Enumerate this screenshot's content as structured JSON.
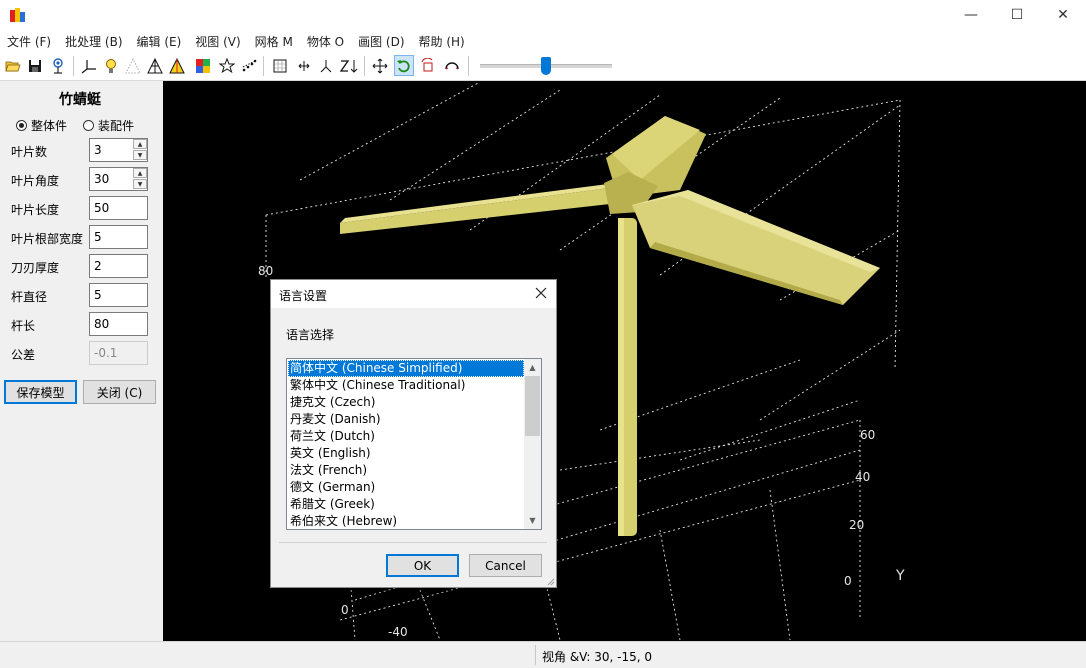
{
  "window": {
    "minimize_glyph": "—",
    "maximize_glyph": "☐",
    "close_glyph": "✕"
  },
  "menu": [
    {
      "id": "file",
      "label": "文件 (F)"
    },
    {
      "id": "batch",
      "label": "批处理 (B)"
    },
    {
      "id": "edit",
      "label": "编辑 (E)"
    },
    {
      "id": "view",
      "label": "视图 (V)"
    },
    {
      "id": "mesh",
      "label": "网格 M"
    },
    {
      "id": "object",
      "label": "物体 O"
    },
    {
      "id": "draw",
      "label": "画图 (D)"
    },
    {
      "id": "help",
      "label": "帮助 (H)"
    }
  ],
  "toolbar": {
    "icons": [
      "open-folder-icon",
      "save-icon",
      "network-icon",
      "axes-icon",
      "lightbulb-icon",
      "mesh-points-icon",
      "wireframe-triangle-icon",
      "colored-triangle-icon",
      "color-map-icon",
      "star-icon",
      "scatter-icon",
      "grid-box-icon",
      "resize-icon",
      "axis-y-icon",
      "zoom-z-icon",
      "move-icon",
      "rotate-icon",
      "box-rotate-icon",
      "arc-icon"
    ],
    "active_icon": "rotate-icon",
    "slider_value_fraction": 0.5
  },
  "panel": {
    "title": "竹蜻蜓",
    "mode_options": [
      "整体件",
      "装配件"
    ],
    "selected_mode": "整体件",
    "params": [
      {
        "label": "叶片数",
        "value": "3",
        "spinner": true,
        "enabled": true
      },
      {
        "label": "叶片角度",
        "value": "30",
        "spinner": true,
        "enabled": true
      },
      {
        "label": "叶片长度",
        "value": "50",
        "spinner": false,
        "enabled": true
      },
      {
        "label": "叶片根部宽度",
        "value": "5",
        "spinner": false,
        "enabled": true
      },
      {
        "label": "刀刃厚度",
        "value": "2",
        "spinner": false,
        "enabled": true
      },
      {
        "label": "杆直径",
        "value": "5",
        "spinner": false,
        "enabled": true
      },
      {
        "label": "杆长",
        "value": "80",
        "spinner": false,
        "enabled": true
      },
      {
        "label": "公差",
        "value": "-0.1",
        "spinner": false,
        "enabled": false
      }
    ],
    "save_button": "保存模型",
    "close_button": "关闭 (C)"
  },
  "viewport": {
    "background": "#000000",
    "model_color": "#d9d27a",
    "grid_color": "#e6e6e6",
    "axis_labels": [
      "80",
      "0",
      "-40",
      "60",
      "40",
      "20",
      "0",
      "Y"
    ]
  },
  "dialog": {
    "title": "语言设置",
    "prompt": "语言选择",
    "languages": [
      "简体中文 (Chinese Simplified)",
      "繁体中文 (Chinese Traditional)",
      "捷克文 (Czech)",
      "丹麦文 (Danish)",
      "荷兰文 (Dutch)",
      "英文 (English)",
      "法文 (French)",
      "德文 (German)",
      "希腊文 (Greek)",
      "希伯来文 (Hebrew)"
    ],
    "selected_index": 0,
    "ok_label": "OK",
    "cancel_label": "Cancel"
  },
  "status": {
    "view_text": "视角 &V: 30, -15, 0"
  }
}
